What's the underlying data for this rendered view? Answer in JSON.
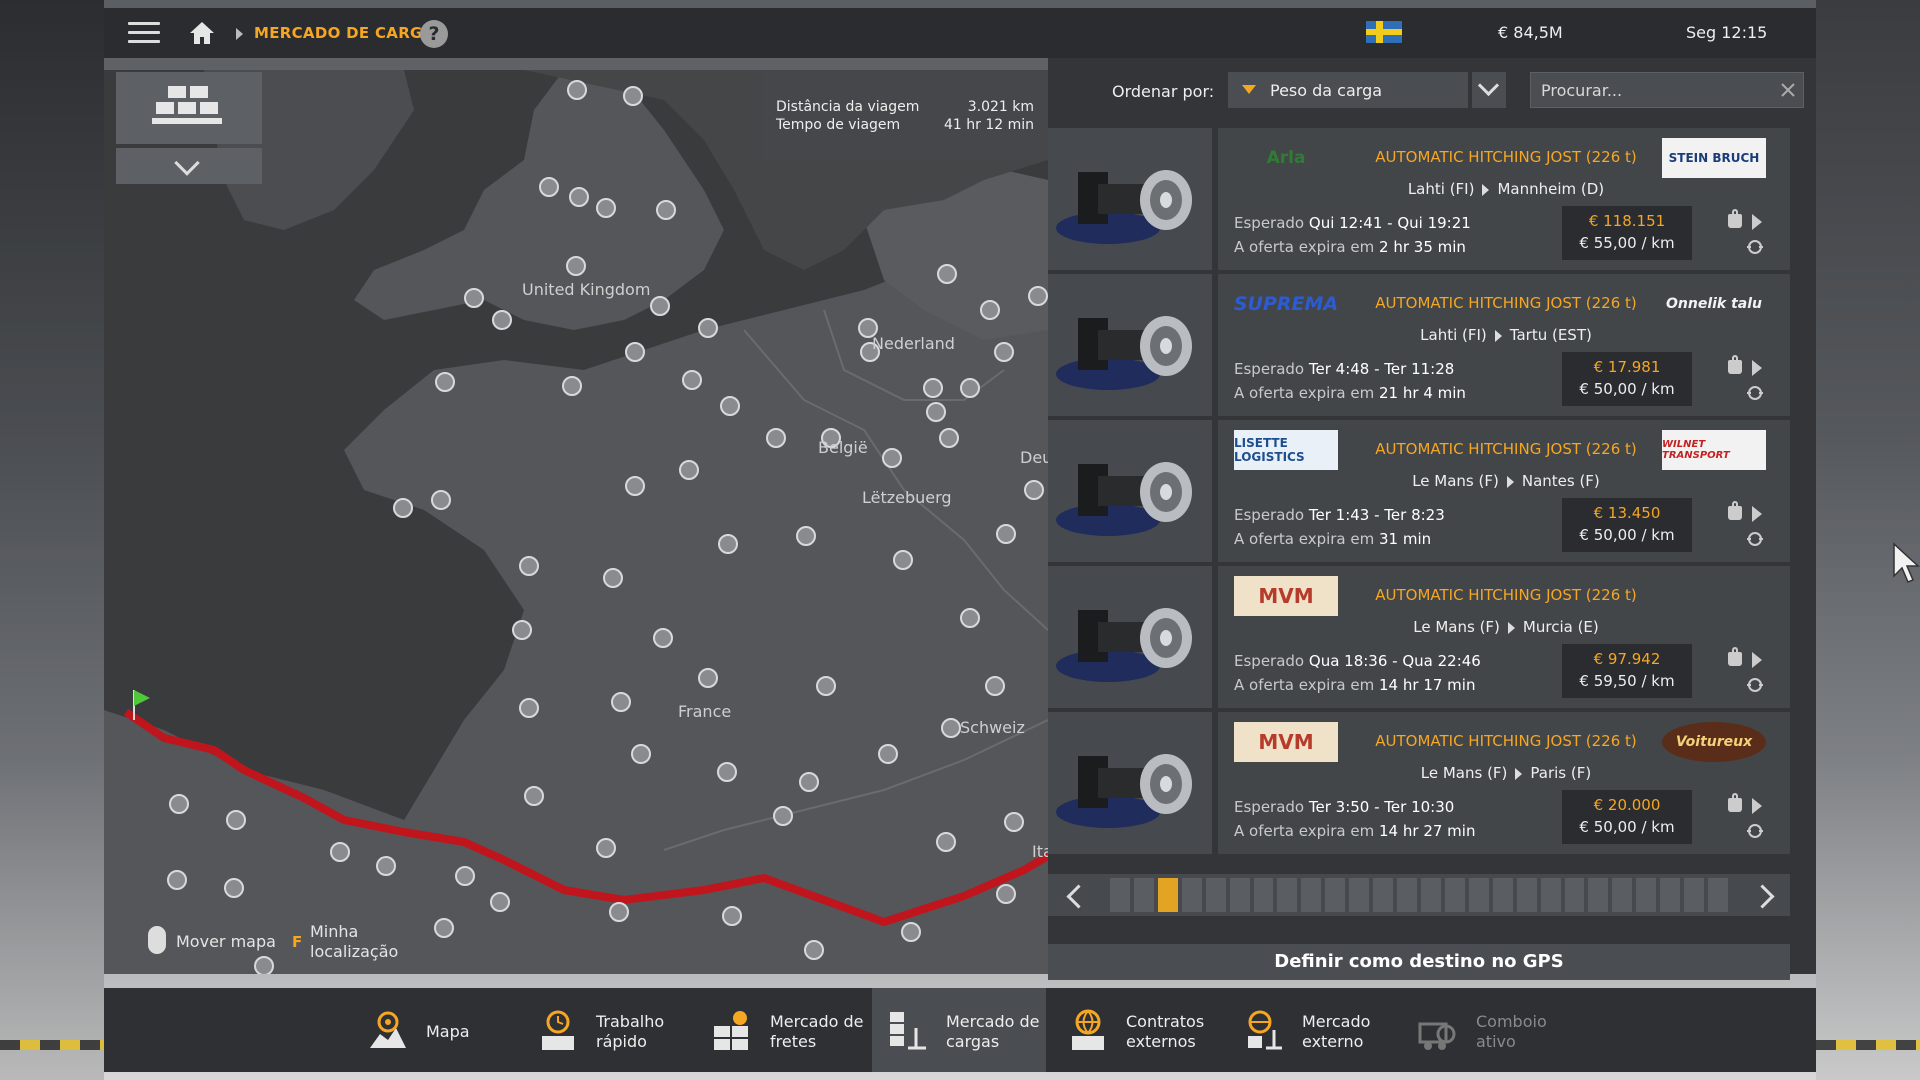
{
  "topbar": {
    "breadcrumb": "MERCADO DE CARGAS",
    "help": "?",
    "money": "€ 84,5M",
    "clock": "Seg 12:15"
  },
  "map": {
    "trip": {
      "distance_label": "Distância da viagem",
      "distance_value": "3.021 km",
      "time_label": "Tempo de viagem",
      "time_value": "41 hr 12 min"
    },
    "labels": [
      "United Kingdom",
      "Nederland",
      "België",
      "Lëtzebuerg",
      "Deu",
      "France",
      "Schweiz",
      "Ita"
    ],
    "hints": {
      "move_label": "Mover mapa",
      "loc_key": "F",
      "loc_label_1": "Minha",
      "loc_label_2": "localização"
    }
  },
  "sort": {
    "label": "Ordenar por:",
    "value": "Peso da carga",
    "search_placeholder": "Procurar..."
  },
  "offers": [
    {
      "logo_left": "Arla",
      "logo_right": "STEIN BRUCH",
      "cargo": "AUTOMATIC HITCHING JOST (226 t)",
      "origin": "Lahti (FI)",
      "destination": "Mannheim (D)",
      "expected_label": "Esperado",
      "expected_value": "Qui 12:41 - Qui 19:21",
      "expires_label": "A oferta expira em",
      "expires_value": "2 hr 35 min",
      "total": "€ 118.151",
      "per_km": "€ 55,00 / km"
    },
    {
      "logo_left": "SUPREMA",
      "logo_right": "Onnelik talu",
      "cargo": "AUTOMATIC HITCHING JOST (226 t)",
      "origin": "Lahti (FI)",
      "destination": "Tartu (EST)",
      "expected_label": "Esperado",
      "expected_value": "Ter 4:48 - Ter 11:28",
      "expires_label": "A oferta expira em",
      "expires_value": "21 hr 4 min",
      "total": "€ 17.981",
      "per_km": "€ 50,00 / km"
    },
    {
      "logo_left": "LISETTE LOGISTICS",
      "logo_right": "WILNET TRANSPORT",
      "cargo": "AUTOMATIC HITCHING JOST (226 t)",
      "origin": "Le Mans (F)",
      "destination": "Nantes (F)",
      "expected_label": "Esperado",
      "expected_value": "Ter 1:43 - Ter 8:23",
      "expires_label": "A oferta expira em",
      "expires_value": "31 min",
      "total": "€ 13.450",
      "per_km": "€ 50,00 / km"
    },
    {
      "logo_left": "MVM",
      "logo_right": "",
      "cargo": "AUTOMATIC HITCHING JOST (226 t)",
      "origin": "Le Mans (F)",
      "destination": "Murcia (E)",
      "expected_label": "Esperado",
      "expected_value": "Qua 18:36 - Qua 22:46",
      "expires_label": "A oferta expira em",
      "expires_value": "14 hr 17 min",
      "total": "€ 97.942",
      "per_km": "€ 59,50 / km"
    },
    {
      "logo_left": "MVM",
      "logo_right": "Voitureux",
      "cargo": "AUTOMATIC HITCHING JOST (226 t)",
      "origin": "Le Mans (F)",
      "destination": "Paris (F)",
      "expected_label": "Esperado",
      "expected_value": "Ter 3:50 - Ter 10:30",
      "expires_label": "A oferta expira em",
      "expires_value": "14 hr 27 min",
      "total": "€ 20.000",
      "per_km": "€ 50,00 / km"
    }
  ],
  "pager": {
    "total_pages": 26,
    "active_page": 3
  },
  "gps_button": "Definir como destino no GPS",
  "bottom_nav": [
    {
      "l1": "Mapa",
      "l2": ""
    },
    {
      "l1": "Trabalho",
      "l2": "rápido"
    },
    {
      "l1": "Mercado de",
      "l2": "fretes"
    },
    {
      "l1": "Mercado de",
      "l2": "cargas"
    },
    {
      "l1": "Contratos",
      "l2": "externos"
    },
    {
      "l1": "Mercado",
      "l2": "externo"
    },
    {
      "l1": "Comboio",
      "l2": "ativo"
    }
  ],
  "colors": {
    "accent": "#f5a623",
    "route": "#c0151c",
    "panel": "#333538"
  },
  "icons": [
    "menu-icon",
    "home-icon",
    "help-icon",
    "flag-icon",
    "weight-icon",
    "play-icon",
    "tow-icon",
    "map-icon",
    "clock-icon",
    "crate-icon",
    "globe-icon",
    "convoy-icon"
  ]
}
